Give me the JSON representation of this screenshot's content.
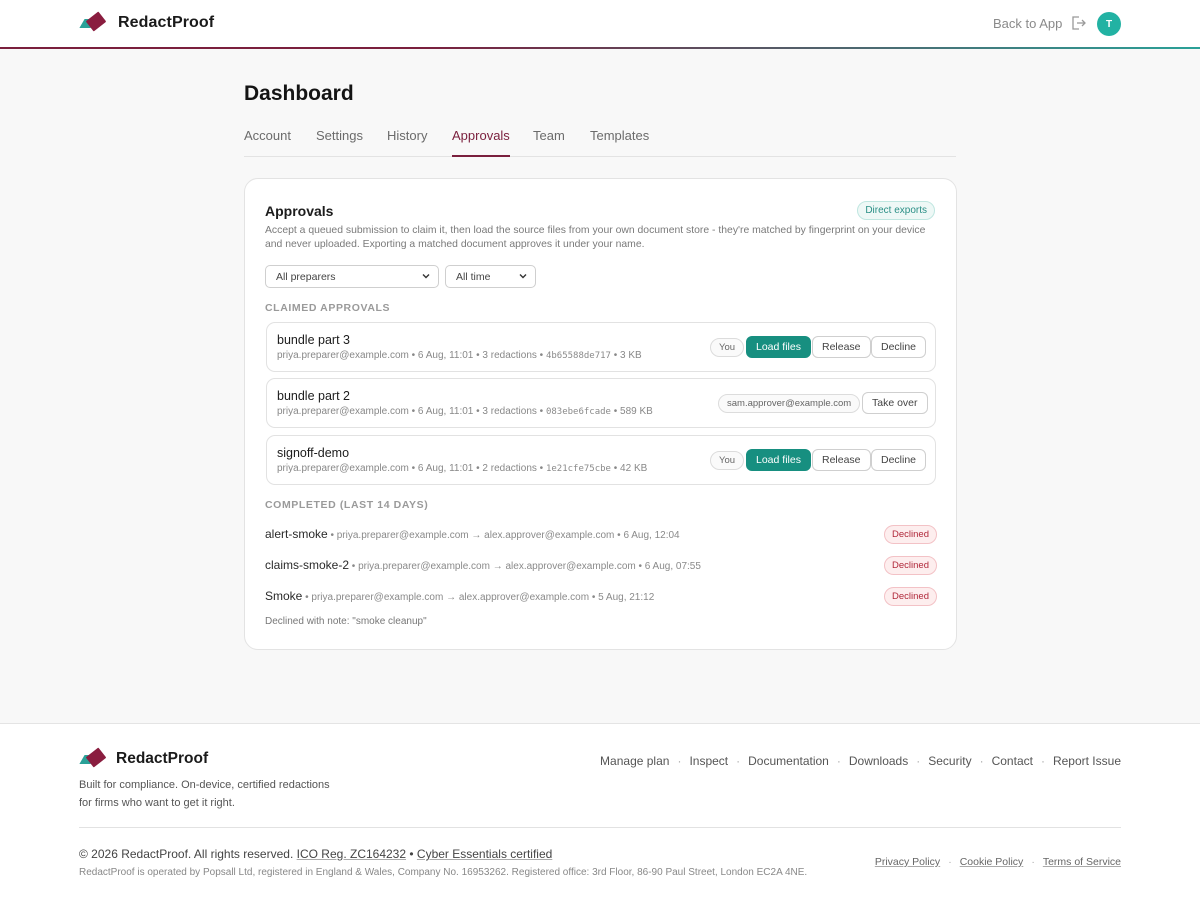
{
  "header": {
    "brand": "RedactProof",
    "back_label": "Back to App",
    "avatar_initial": "T"
  },
  "page": {
    "title": "Dashboard",
    "tabs": [
      {
        "label": "Account",
        "active": false
      },
      {
        "label": "Settings",
        "active": false
      },
      {
        "label": "History",
        "active": false
      },
      {
        "label": "Approvals",
        "active": true
      },
      {
        "label": "Team",
        "active": false
      },
      {
        "label": "Templates",
        "active": false
      }
    ]
  },
  "approvals": {
    "title": "Approvals",
    "badge": "Direct exports",
    "description": "Accept a queued submission to claim it, then load the source files from your own document store - they're matched by fingerprint on your device and never uploaded. Exporting a matched document approves it under your name.",
    "filters": {
      "preparer": "All preparers",
      "time": "All time"
    },
    "claimed_label": "CLAIMED APPROVALS",
    "claimed": [
      {
        "name": "bundle part 3",
        "meta": "priya.preparer@example.com • 6 Aug, 11:01 • 3 redactions • ",
        "hash": "4b65588de717",
        "size": " • 3 KB",
        "owner_chip": "You",
        "load": "Load files",
        "release": "Release",
        "decline": "Decline"
      },
      {
        "name": "bundle part 2",
        "meta": "priya.preparer@example.com • 6 Aug, 11:01 • 3 redactions • ",
        "hash": "083ebe6fcade",
        "size": " • 589 KB",
        "owner_chip": "sam.approver@example.com",
        "takeover": "Take over"
      },
      {
        "name": "signoff-demo",
        "meta": "priya.preparer@example.com • 6 Aug, 11:01 • 2 redactions • ",
        "hash": "1e21cfe75cbe",
        "size": " • 42 KB",
        "owner_chip": "You",
        "load": "Load files",
        "release": "Release",
        "decline": "Decline"
      }
    ],
    "completed_label": "COMPLETED (LAST 14 DAYS)",
    "completed": [
      {
        "name": "alert-smoke",
        "meta": " • priya.preparer@example.com → alex.approver@example.com • 6 Aug, 12:04",
        "status": "Declined"
      },
      {
        "name": "claims-smoke-2",
        "meta": " • priya.preparer@example.com → alex.approver@example.com • 6 Aug, 07:55",
        "status": "Declined"
      },
      {
        "name": "Smoke",
        "meta": " • priya.preparer@example.com → alex.approver@example.com • 5 Aug, 21:12",
        "status": "Declined"
      }
    ],
    "note": "Declined with note: \"smoke cleanup\""
  },
  "footer": {
    "brand": "RedactProof",
    "tagline_1": "Built for compliance. On-device, certified redactions",
    "tagline_2": "for firms who want to get it right.",
    "links": [
      "Manage plan",
      "Inspect",
      "Documentation",
      "Downloads",
      "Security",
      "Contact",
      "Report Issue"
    ],
    "copyright": "© 2026 RedactProof. All rights reserved.",
    "ico": "ICO Reg. ZC164232",
    "cyber": "Cyber Essentials certified",
    "registered": "RedactProof is operated by Popsall Ltd, registered in England & Wales, Company No. 16953262. Registered office: 3rd Floor, 86-90 Paul Street, London EC2A 4NE.",
    "legal": [
      "Privacy Policy",
      "Cookie Policy",
      "Terms of Service"
    ]
  },
  "colors": {
    "brand_primary": "#7a1f3d",
    "accent_teal": "#178f80",
    "declined": "#b0283a"
  }
}
